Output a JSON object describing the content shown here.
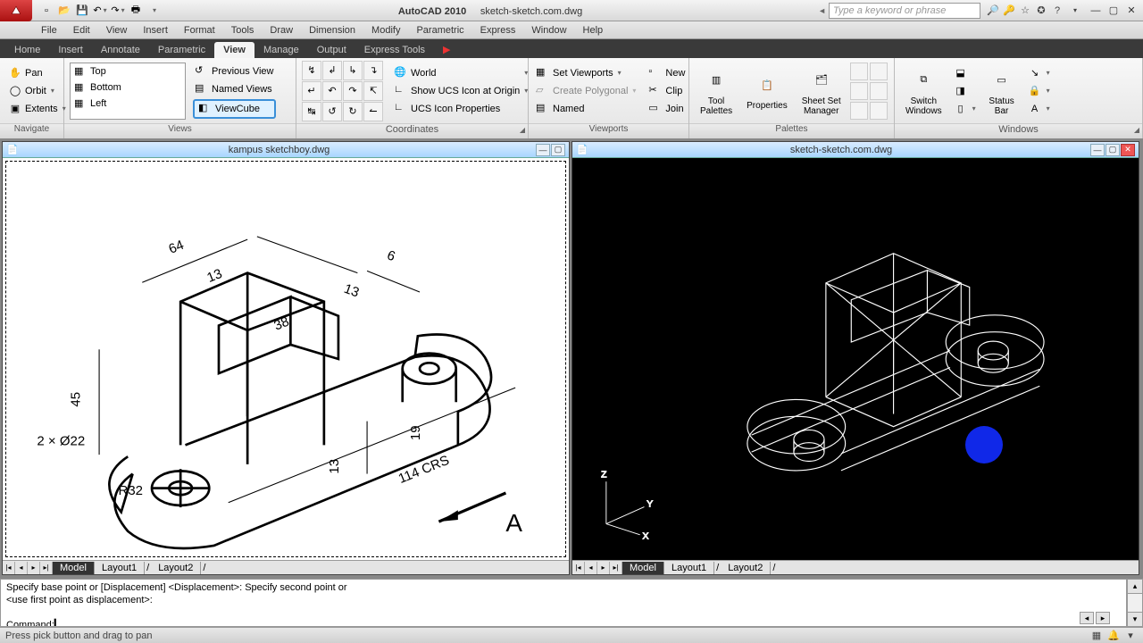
{
  "title": {
    "app": "AutoCAD 2010",
    "file": "sketch-sketch.com.dwg"
  },
  "search": {
    "placeholder": "Type a keyword or phrase"
  },
  "menubar": [
    "File",
    "Edit",
    "View",
    "Insert",
    "Format",
    "Tools",
    "Draw",
    "Dimension",
    "Modify",
    "Parametric",
    "Express",
    "Window",
    "Help"
  ],
  "ribbon_tabs": [
    "Home",
    "Insert",
    "Annotate",
    "Parametric",
    "View",
    "Manage",
    "Output",
    "Express Tools"
  ],
  "ribbon_active": "View",
  "panels": {
    "navigate": {
      "title": "Navigate",
      "items": [
        "Pan",
        "Orbit",
        "Extents"
      ]
    },
    "views": {
      "title": "Views",
      "list": [
        "Top",
        "Bottom",
        "Left"
      ],
      "btns": [
        "Previous View",
        "Named Views",
        "ViewCube"
      ]
    },
    "coords": {
      "title": "Coordinates",
      "world": "World",
      "show_ucs": "Show UCS Icon at Origin",
      "ucs_props": "UCS Icon Properties"
    },
    "viewports": {
      "title": "Viewports",
      "set": "Set Viewports",
      "create_poly": "Create Polygonal",
      "named": "Named",
      "new": "New",
      "clip": "Clip",
      "join": "Join"
    },
    "palettes": {
      "title": "Palettes",
      "tool": "Tool\nPalettes",
      "props": "Properties",
      "sheet": "Sheet Set\nManager"
    },
    "windows": {
      "title": "Windows",
      "switch": "Switch\nWindows",
      "status": "Status\nBar"
    }
  },
  "docs": {
    "left": {
      "title": "kampus sketchboy.dwg",
      "tabs": [
        "Model",
        "Layout1",
        "Layout2"
      ],
      "active": "Model"
    },
    "right": {
      "title": "sketch-sketch.com.dwg",
      "tabs": [
        "Model",
        "Layout1",
        "Layout2"
      ],
      "active": "Model"
    }
  },
  "drawing_dims": {
    "d64": "64",
    "d13a": "13",
    "d6x": "6",
    "d13b": "13",
    "d38": "38",
    "d45": "45",
    "d19": "19",
    "d13c": "13",
    "d114": "114 CRS",
    "hole_note": "2 × Ø22",
    "rad": "R32",
    "arrow_label": "A"
  },
  "ucs_axes": {
    "x": "X",
    "y": "Y",
    "z": "Z"
  },
  "command": {
    "line1": "Specify base point or [Displacement] <Displacement>: Specify second point or",
    "line2": "<use first point as displacement>:",
    "prompt": "Command:"
  },
  "status": {
    "hint": "Press pick button and drag to pan"
  }
}
